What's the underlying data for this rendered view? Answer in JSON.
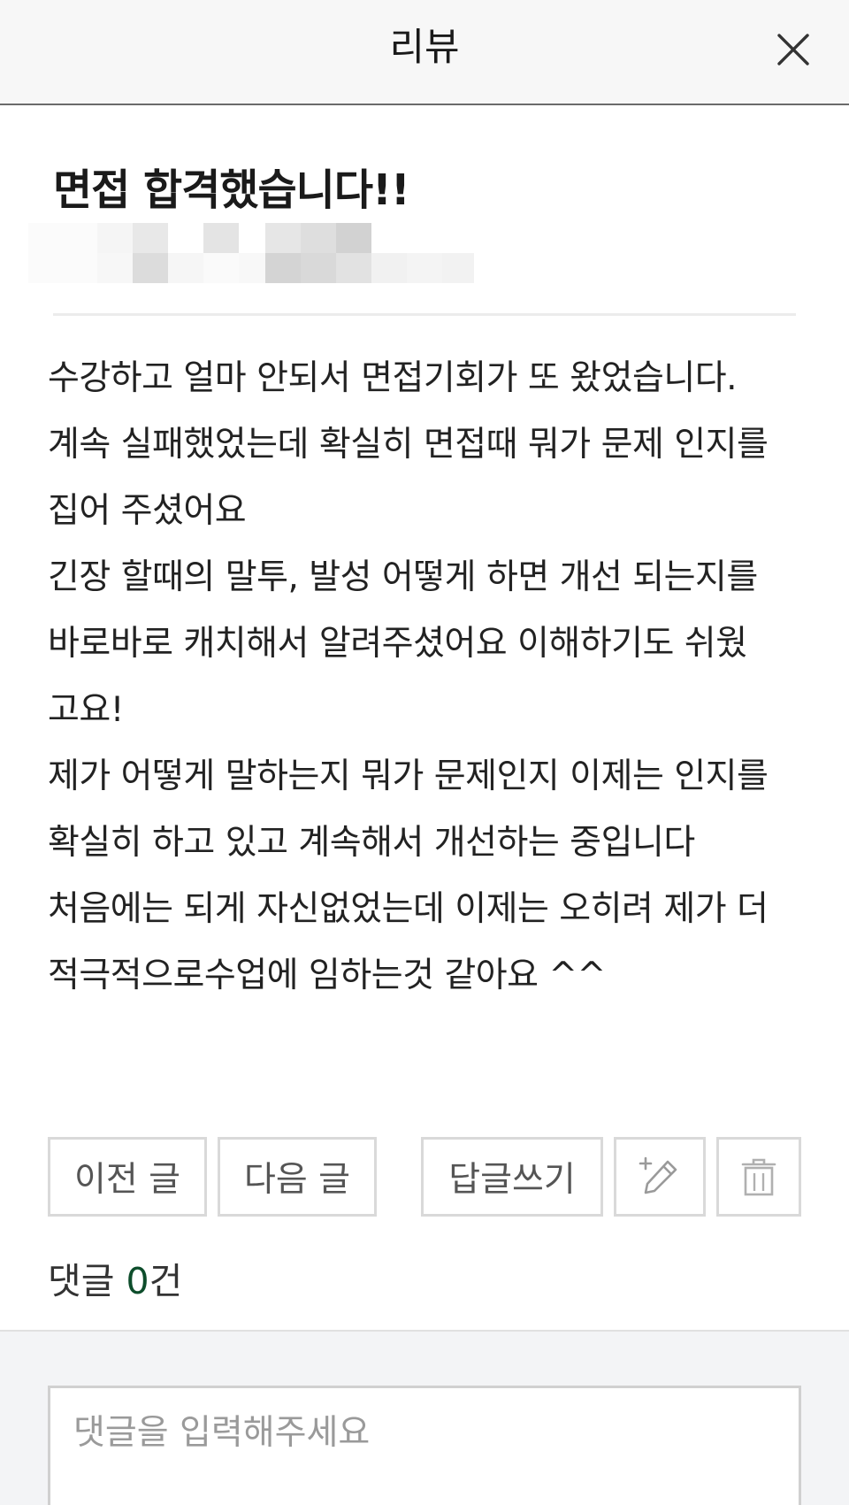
{
  "header": {
    "title": "리뷰"
  },
  "post": {
    "title": "면접 합격했습니다!!",
    "body_lines": [
      "수강하고 얼마 안되서 면접기회가 또 왔었습니다.",
      "계속 실패했었는데 확실히 면접때 뭐가 문제 인지를",
      "집어 주셨어요",
      "긴장 할때의 말투, 발성 어떻게 하면 개선 되는지를",
      "바로바로 캐치해서 알려주셨어요 이해하기도 쉬웠",
      "고요!",
      "제가 어떻게 말하는지 뭐가 문제인지 이제는 인지를",
      "확실히 하고 있고 계속해서 개선하는 중입니다",
      "처음에는 되게 자신없었는데 이제는 오히려 제가 더",
      "적극적으로수업에 임하는것 같아요 ^^"
    ]
  },
  "actions": {
    "prev_label": "이전 글",
    "next_label": "다음 글",
    "reply_label": "답글쓰기",
    "edit_icon": "pencil-plus-icon",
    "delete_icon": "trash-icon"
  },
  "comments": {
    "label": "댓글",
    "count": "0",
    "unit": "건",
    "placeholder": "댓글을 입력해주세요"
  },
  "colors": {
    "header_bg": "#f7f7f7",
    "border": "#d9d9d9",
    "count_accent": "#0d4d2b",
    "comment_area_bg": "#f3f4f6"
  }
}
